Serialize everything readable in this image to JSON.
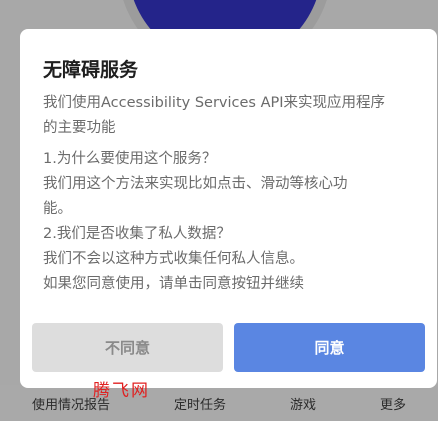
{
  "dialog": {
    "title": "无障碍服务",
    "intro_lines": [
      "我们使用Accessibility Services API来实现应用程序",
      "的主要功能"
    ],
    "body_lines": [
      "1.为什么要使用这个服务？",
      "我们用这个方法来实现比如点击、滑动等核心功",
      "能。",
      "2.我们是否收集了私人数据？",
      "我们不会以这种方式收集任何私人信息。",
      "如果您同意使用，请单击同意按钮并继续"
    ],
    "disagree_label": "不同意",
    "agree_label": "同意"
  },
  "background": {
    "bottom_nav": [
      "使用情况报告",
      "定时任务",
      "游戏",
      "更多"
    ]
  },
  "watermark": "腾飞网",
  "colors": {
    "agree_button": "#5a86e2",
    "disagree_button": "#dddddd",
    "circle": "#24248a"
  }
}
